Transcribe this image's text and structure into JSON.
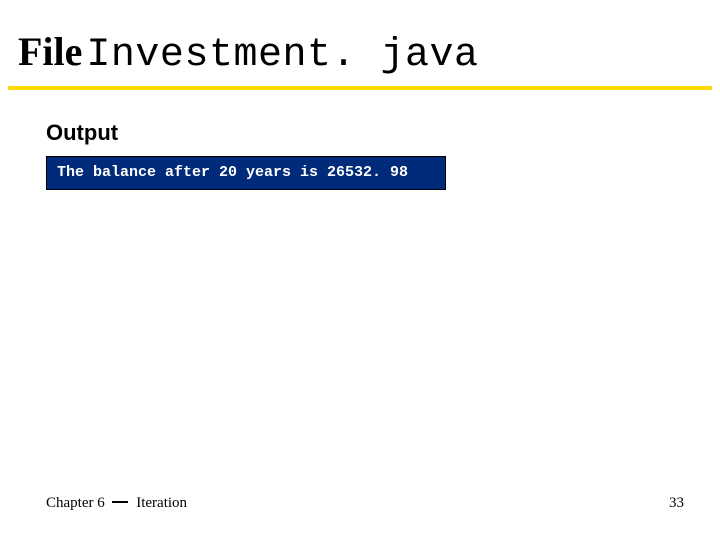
{
  "title": {
    "prefix": "File",
    "filename": " Investment. java"
  },
  "subhead": "Output",
  "output": "The balance after 20 years is 26532. 98",
  "footer": {
    "chapter_prefix": "Chapter 6",
    "chapter_topic": "Iteration",
    "page": "33"
  }
}
